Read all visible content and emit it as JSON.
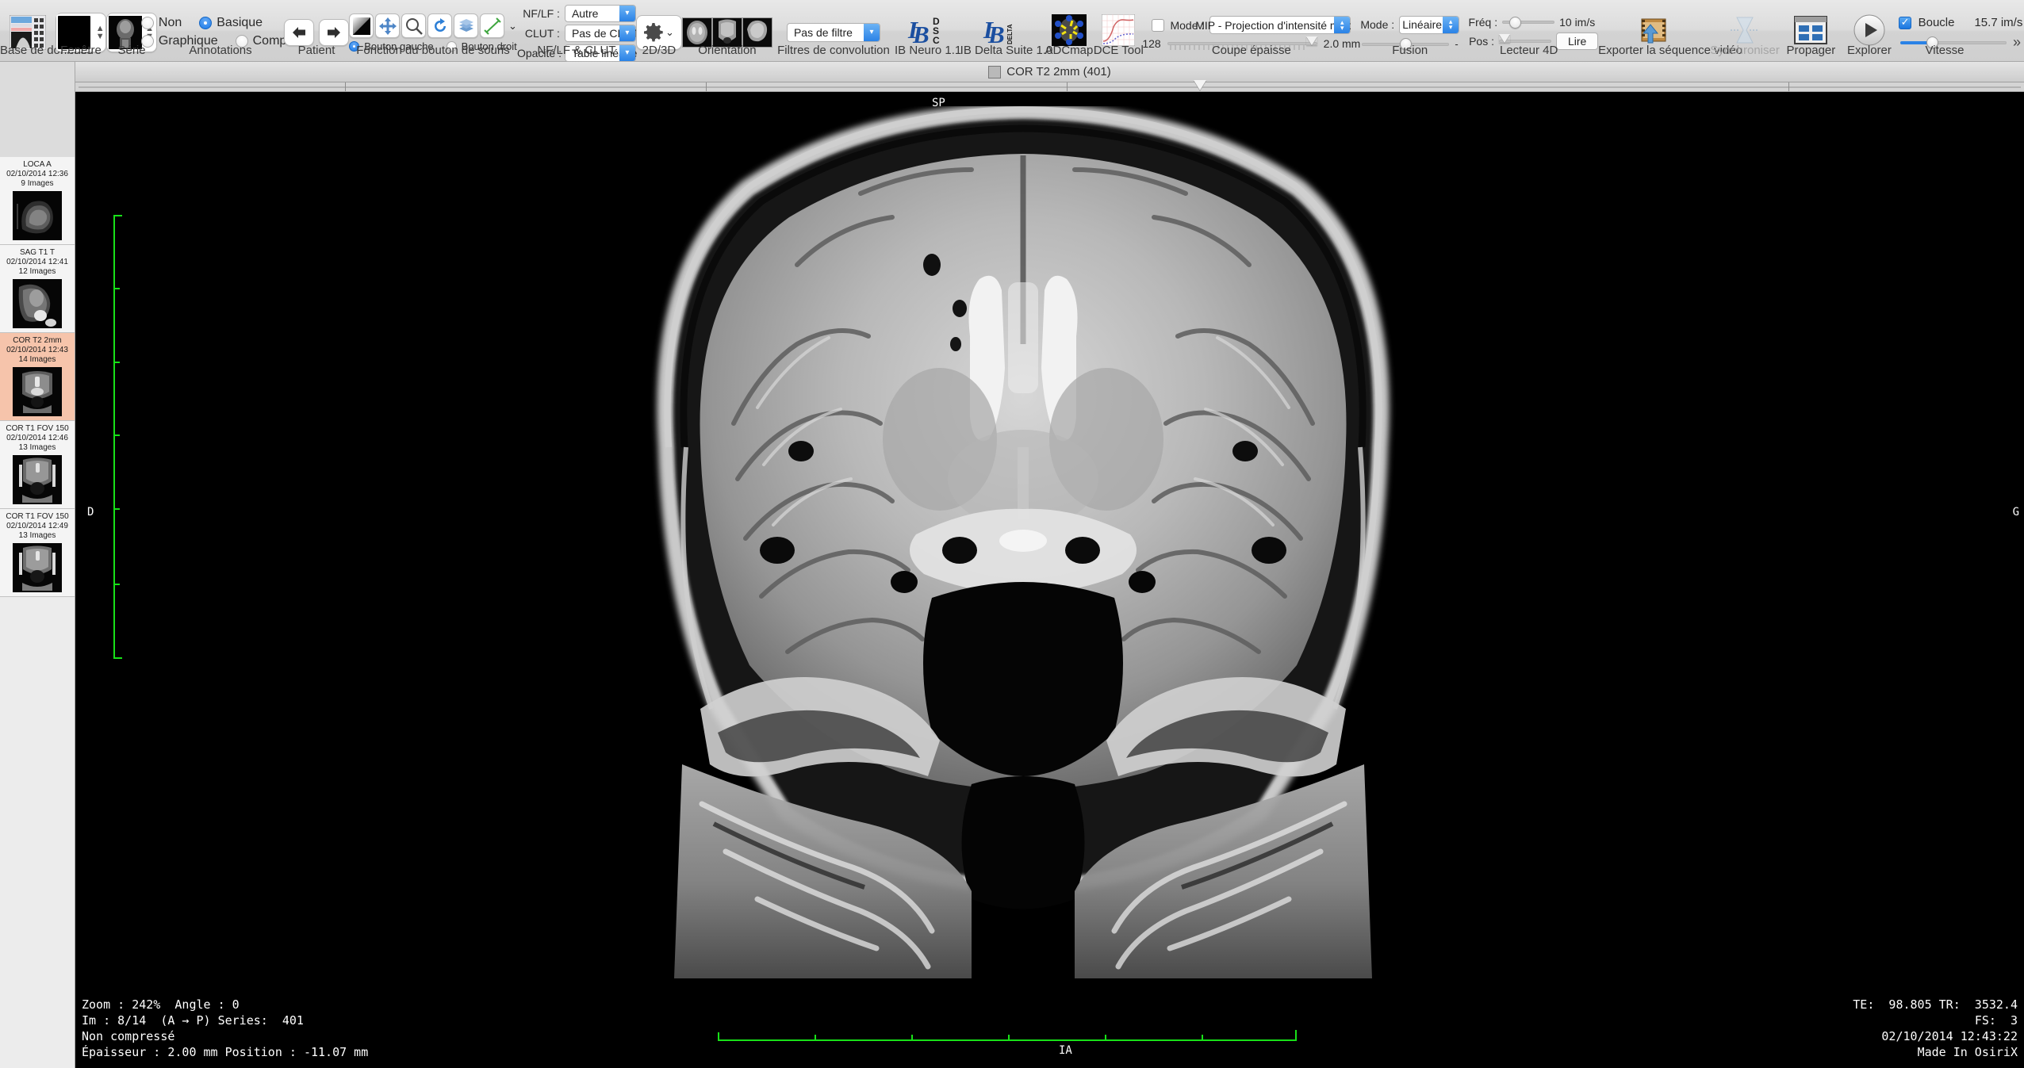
{
  "toolbar": {
    "groups": [
      {
        "id": "database",
        "label": "Base de données",
        "icon": "database-icon"
      },
      {
        "id": "window",
        "label": "Fenêtre",
        "icon": "window-preset-icon"
      },
      {
        "id": "series",
        "label": "Série",
        "icon": "series-preset-icon"
      },
      {
        "id": "annotations",
        "label": "Annotations"
      },
      {
        "id": "patient",
        "label": "Patient"
      },
      {
        "id": "mouse",
        "label": "Fonction du bouton de souris"
      },
      {
        "id": "nflf",
        "label": "NF/LF & CLUT"
      },
      {
        "id": "2d3d",
        "label": "2D/3D"
      },
      {
        "id": "orientation",
        "label": "Orientation"
      },
      {
        "id": "convolution",
        "label": "Filtres de convolution"
      },
      {
        "id": "ibneuro",
        "label": "IB Neuro 1.1"
      },
      {
        "id": "ibdelta",
        "label": "IB Delta Suite 1.0"
      },
      {
        "id": "adcmap",
        "label": "ADCmap"
      },
      {
        "id": "dcetool",
        "label": "DCE Tool"
      },
      {
        "id": "thickslab",
        "label": "Coupe épaisse"
      },
      {
        "id": "fusion",
        "label": "Fusion"
      },
      {
        "id": "lecteur4d",
        "label": "Lecteur 4D"
      },
      {
        "id": "exportvideo",
        "label": "Exporter la séquence vidéo"
      },
      {
        "id": "sync",
        "label": "Synchroniser",
        "disabled": true
      },
      {
        "id": "propagate",
        "label": "Propager"
      },
      {
        "id": "explorer",
        "label": "Explorer"
      },
      {
        "id": "vitesse",
        "label": "Vitesse"
      }
    ],
    "annotations": {
      "options": [
        "Non",
        "Basique",
        "Graphique",
        "Complet"
      ],
      "selected": "Basique"
    },
    "mouse_buttons": {
      "options": [
        "Bouton gauche",
        "Bouton droit"
      ],
      "selected": "Bouton gauche",
      "tools": [
        "wl-icon",
        "move-icon",
        "zoom-icon",
        "rotate-icon",
        "stack-icon",
        "length-icon"
      ],
      "more": "⌄"
    },
    "nflf_clut": {
      "nflf_label": "NF/LF :",
      "nflf_value": "Autre",
      "clut_label": "CLUT :",
      "clut_value": "Pas de CLUT",
      "opacity_label": "Opacité :",
      "opacity_value": "Table linéaire"
    },
    "d2d3": {
      "icon": "gear-icon",
      "chevron": "⌄"
    },
    "convolution": {
      "value": "Pas de filtre"
    },
    "thickslab": {
      "mode_label": "Mode :",
      "mode_value": "MIP - Projection d'intensité max",
      "checked": false,
      "slices": "128",
      "thickness": "2.0 mm"
    },
    "fusion": {
      "mode_label": "Mode :",
      "mode_value": "Linéaire",
      "suffix": "-"
    },
    "player4d": {
      "freq_label": "Fréq :",
      "freq_value": "10 im/s",
      "pos_label": "Pos :",
      "play_label": "Lire"
    },
    "speed": {
      "loop_label": "Boucle",
      "loop_checked": true,
      "rate": "15.7 im/s",
      "overflow": "»"
    }
  },
  "window": {
    "title": "COR T2 2mm (401)"
  },
  "sidebar": {
    "series": [
      {
        "name": "LOCA A",
        "datetime": "02/10/2014 12:36",
        "count": "9 Images",
        "active": false
      },
      {
        "name": "SAG T1 T",
        "datetime": "02/10/2014 12:41",
        "count": "12 Images",
        "active": false
      },
      {
        "name": "COR T2 2mm",
        "datetime": "02/10/2014 12:43",
        "count": "14 Images",
        "active": true
      },
      {
        "name": "COR T1 FOV 150",
        "datetime": "02/10/2014 12:46",
        "count": "13 Images",
        "active": false
      },
      {
        "name": "COR T1 FOV 150",
        "datetime": "02/10/2014 12:49",
        "count": "13 Images",
        "active": false
      }
    ]
  },
  "viewer": {
    "orientation_top": "SP",
    "orientation_left": "D",
    "orientation_right": "G",
    "orientation_bottom": "IA",
    "info_bottom_left": "Zoom : 242%  Angle : 0\nIm : 8/14  (A → P) Series:  401\nNon compressé\nÉpaisseur : 2.00 mm Position : -11.07 mm",
    "info_bottom_right": "TE:  98.805 TR:  3532.4\nFS:  3\n02/10/2014 12:43:22\nMade In OsiriX",
    "zoom_value": "242%",
    "angle_value": "0",
    "image_index": "8/14",
    "series_number": "401",
    "compression": "Non compressé",
    "thickness": "2.00 mm",
    "position": "-11.07 mm",
    "te": "98.805",
    "tr": "3532.4",
    "fs": "3",
    "acquired": "02/10/2014 12:43:22",
    "watermark": "Made In OsiriX"
  },
  "colors": {
    "accent": "#2a82e6",
    "active_series": "#f6c4ab",
    "ruler": "#18e018",
    "toolbar_bg": "#dcdcdc"
  }
}
